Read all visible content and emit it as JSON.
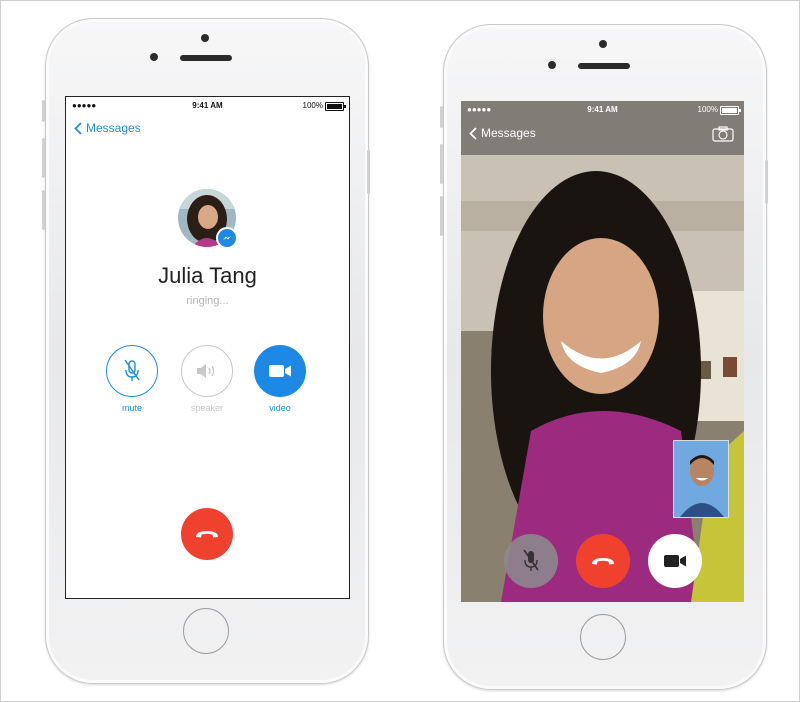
{
  "colors": {
    "accent": "#1d8fd8",
    "end_call": "#f0412f",
    "speaker_gray": "#c8c8c8",
    "video_blue": "#1e88e5"
  },
  "left_phone": {
    "status": {
      "signal": "●●●●● ",
      "time": "9:41 AM",
      "battery": "100%"
    },
    "nav": {
      "back_label": "Messages",
      "back_icon": "chevron-left-icon"
    },
    "caller": {
      "name": "Julia Tang",
      "status": "ringing..."
    },
    "controls": [
      {
        "label": "mute",
        "icon": "microphone-muted-icon"
      },
      {
        "label": "speaker",
        "icon": "speaker-icon"
      },
      {
        "label": "video",
        "icon": "video-camera-icon"
      }
    ],
    "end_call_icon": "phone-hangup-icon"
  },
  "right_phone": {
    "status": {
      "signal": "●●●●● ",
      "time": "9:41 AM",
      "battery": "100%"
    },
    "nav": {
      "back_label": "Messages",
      "back_icon": "chevron-left-icon"
    },
    "flip_camera_icon": "camera-flip-icon",
    "controls": [
      {
        "icon": "microphone-muted-icon"
      },
      {
        "icon": "phone-hangup-icon"
      },
      {
        "icon": "video-camera-icon"
      }
    ]
  }
}
